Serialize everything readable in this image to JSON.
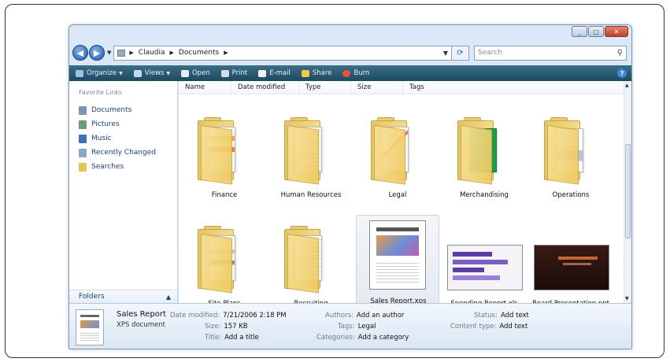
{
  "address_bar": {
    "crumbs": [
      "Claudia",
      "Documents"
    ],
    "search_placeholder": "Search"
  },
  "toolbar": {
    "items": [
      {
        "label": "Organize",
        "icon": "organize-icon",
        "has_menu": true
      },
      {
        "label": "Views",
        "icon": "views-icon",
        "has_menu": true
      },
      {
        "label": "Open",
        "icon": "open-icon",
        "has_menu": false
      },
      {
        "label": "Print",
        "icon": "print-icon",
        "has_menu": false
      },
      {
        "label": "E-mail",
        "icon": "email-icon",
        "has_menu": false
      },
      {
        "label": "Share",
        "icon": "share-icon",
        "has_menu": false
      },
      {
        "label": "Burn",
        "icon": "burn-icon",
        "has_menu": false
      }
    ]
  },
  "navpane": {
    "heading": "Favorite Links",
    "links": [
      {
        "label": "Documents",
        "icon": "documents-icon"
      },
      {
        "label": "Pictures",
        "icon": "pictures-icon"
      },
      {
        "label": "Music",
        "icon": "music-icon"
      },
      {
        "label": "Recently Changed",
        "icon": "recently-changed-icon"
      },
      {
        "label": "Searches",
        "icon": "searches-icon"
      }
    ],
    "folders_label": "Folders"
  },
  "columns": [
    "Name",
    "Date modified",
    "Type",
    "Size",
    "Tags"
  ],
  "files": [
    {
      "label": "Finance",
      "kind": "folder"
    },
    {
      "label": "Human Resources",
      "kind": "folder"
    },
    {
      "label": "Legal",
      "kind": "folder"
    },
    {
      "label": "Merchandising",
      "kind": "folder"
    },
    {
      "label": "Operations",
      "kind": "folder"
    },
    {
      "label": "Site Plans",
      "kind": "folder"
    },
    {
      "label": "Recruiting",
      "kind": "folder"
    },
    {
      "label": "Sales Report.xps",
      "kind": "xps",
      "selected": true
    },
    {
      "label": "Spending Report.xls",
      "kind": "xls"
    },
    {
      "label": "Board Presentation.ppt",
      "kind": "ppt"
    }
  ],
  "details": {
    "name": "Sales Report",
    "type": "XPS document",
    "date_modified_label": "Date modified:",
    "date_modified": "7/21/2006 2:18 PM",
    "size_label": "Size:",
    "size": "157 KB",
    "title_label": "Title:",
    "title": "Add a title",
    "authors_label": "Authors:",
    "authors": "Add an author",
    "tags_label": "Tags:",
    "tags": "Legal",
    "categories_label": "Categories:",
    "categories": "Add a category",
    "status_label": "Status:",
    "status": "Add text",
    "content_type_label": "Content type:",
    "content_type": "Add text"
  },
  "colors": {
    "toolbar": "#1b4a61",
    "link": "#1f3d7a",
    "folder": "#eec95e"
  }
}
